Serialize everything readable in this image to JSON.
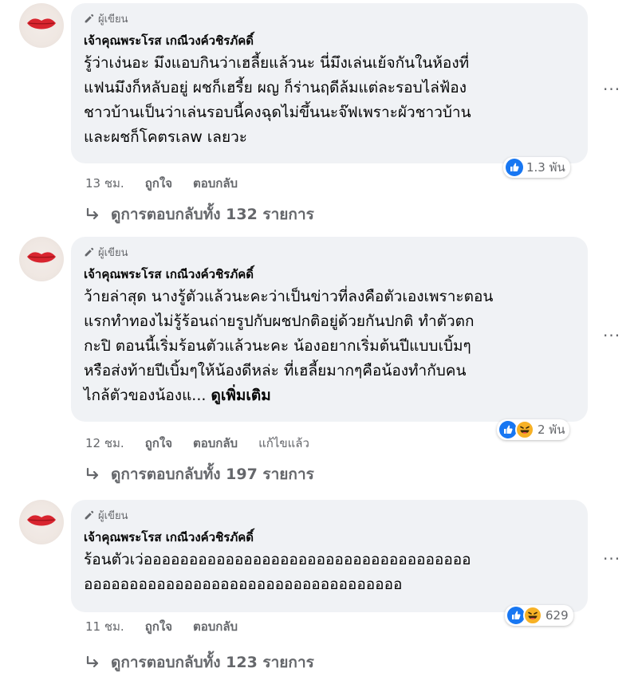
{
  "comments": [
    {
      "badge": "ผู้เขียน",
      "author": "เจ้าคุณพระโรส เกณีวงค์วชิรภัคดิ์",
      "text": "รู้ว่าเง่นอะ มึงแอบกินว่าเฮลี้ยแล้วนะ นี่มึงเล่นเย้จกันในห้องที่\nแฟนมึงก็หลับอยู่ ผชก็เฮรี้ย ผญ ก็ร่านฤดีล้มแต่ละรอบไล่ฟ้อง\nชาวบ้านเป็นว่าเล่นรอบนี้คงฉุดไม่ขึ้นนะจ๊ฟเพราะผัวชาวบ้าน\nและผชก็โคตรเลw เลยวะ",
      "see_more": "",
      "time": "13 ชม.",
      "like": "ถูกใจ",
      "reply": "ตอบกลับ",
      "edited": "",
      "reaction_count": "1.3 พัน",
      "reaction_icons": [
        "like-icon"
      ],
      "replies_label": "ดูการตอบกลับทั้ง 132 รายการ"
    },
    {
      "badge": "ผู้เขียน",
      "author": "เจ้าคุณพระโรส เกณีวงค์วชิรภัคดิ์",
      "text": "ว้ายล่าสุด นางรู้ตัวแล้วนะคะว่าเป็นข่าวที่ลงคือตัวเองเพราะตอน\nแรกทำทองไม่รู้ร้อนถ่ายรูปกับผชปกติอยู่ด้วยกันปกติ ทำตัวตก\nกะปิ ตอนนี้เริ่มร้อนตัวแล้วนะคะ น้องอยากเริ่มต้นปีแบบเบิ้มๆ\nหรือส่งท้ายปีเบิ้มๆให้น้องดีหล่ะ ที่เฮลี้ยมากๆคือน้องทำกับคน\nไกล้ตัวของน้องแ...",
      "see_more": "ดูเพิ่มเติม",
      "time": "12 ชม.",
      "like": "ถูกใจ",
      "reply": "ตอบกลับ",
      "edited": "แก้ไขแล้ว",
      "reaction_count": "2 พัน",
      "reaction_icons": [
        "like-icon",
        "haha-icon"
      ],
      "replies_label": "ดูการตอบกลับทั้ง 197 รายการ"
    },
    {
      "badge": "ผู้เขียน",
      "author": "เจ้าคุณพระโรส เกณีวงค์วชิรภัคดิ์",
      "text": "ร้อนตัวเว่ออออออออออออออออออออออออออออออออออออ\nอออออออออออออออออออออออออออออออออออ",
      "see_more": "",
      "time": "11 ชม.",
      "like": "ถูกใจ",
      "reply": "ตอบกลับ",
      "edited": "",
      "reaction_count": "629",
      "reaction_icons": [
        "like-icon",
        "haha-icon"
      ],
      "replies_label": "ดูการตอบกลับทั้ง 123 รายการ"
    }
  ],
  "colors": {
    "bubble": "#f0f2f5",
    "meta": "#65676b",
    "like": "#1877f2",
    "haha": "#f7b125"
  },
  "more_label": "..."
}
